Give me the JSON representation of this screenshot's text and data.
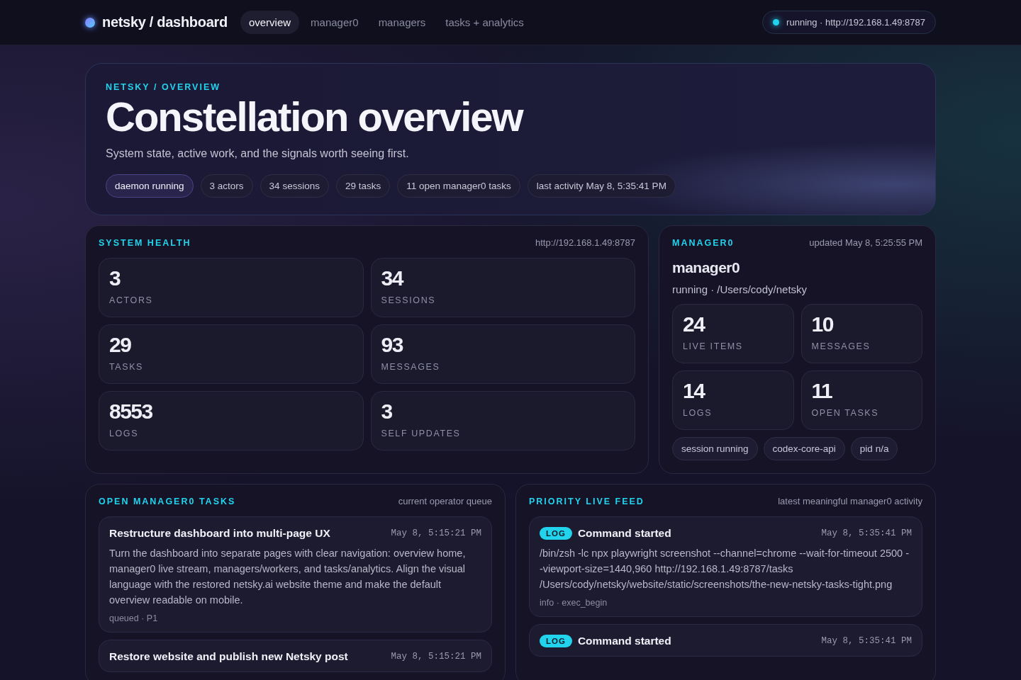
{
  "header": {
    "brand": "netsky / dashboard",
    "tabs": [
      {
        "label": "overview",
        "selected": true
      },
      {
        "label": "manager0",
        "selected": false
      },
      {
        "label": "managers",
        "selected": false
      },
      {
        "label": "tasks + analytics",
        "selected": false
      }
    ],
    "status": {
      "text": "running · http://192.168.1.49:8787",
      "on": true
    }
  },
  "hero": {
    "eyebrow": "NETSKY / OVERVIEW",
    "title": "Constellation overview",
    "subtitle": "System state, active work, and the signals worth seeing first.",
    "chips": [
      {
        "label": "daemon running",
        "kind": "status"
      },
      {
        "label": "3 actors",
        "kind": "plain"
      },
      {
        "label": "34 sessions",
        "kind": "plain"
      },
      {
        "label": "29 tasks",
        "kind": "plain"
      },
      {
        "label": "11 open manager0 tasks",
        "kind": "plain"
      },
      {
        "label": "last activity May 8, 5:35:41 PM",
        "kind": "plain"
      }
    ]
  },
  "system_health": {
    "heading": "SYSTEM HEALTH",
    "note": "http://192.168.1.49:8787",
    "stats": [
      {
        "value": "3",
        "label": "ACTORS"
      },
      {
        "value": "34",
        "label": "SESSIONS"
      },
      {
        "value": "29",
        "label": "TASKS"
      },
      {
        "value": "93",
        "label": "MESSAGES"
      },
      {
        "value": "8553",
        "label": "LOGS"
      },
      {
        "value": "3",
        "label": "SELF UPDATES"
      }
    ]
  },
  "manager": {
    "heading": "MANAGER0",
    "note": "updated May 8, 5:25:55 PM",
    "name": "manager0",
    "detail": "running · /Users/cody/netsky",
    "stats": [
      {
        "value": "24",
        "label": "LIVE ITEMS"
      },
      {
        "value": "10",
        "label": "MESSAGES"
      },
      {
        "value": "14",
        "label": "LOGS"
      },
      {
        "value": "11",
        "label": "OPEN TASKS"
      }
    ],
    "chips": [
      "session running",
      "codex-core-api",
      "pid n/a"
    ]
  },
  "open_tasks": {
    "heading": "OPEN MANAGER0 TASKS",
    "note": "current operator queue",
    "items": [
      {
        "title": "Restructure dashboard into multi-page UX",
        "time": "May 8, 5:15:21 PM",
        "body": "Turn the dashboard into separate pages with clear navigation: overview home, manager0 live stream, managers/workers, and tasks/analytics. Align the visual language with the restored netsky.ai website theme and make the default overview readable on mobile.",
        "meta": "queued · P1"
      },
      {
        "title": "Restore website and publish new Netsky post",
        "time": "May 8, 5:15:21 PM"
      }
    ]
  },
  "live_feed": {
    "heading": "PRIORITY LIVE FEED",
    "note": "latest meaningful manager0 activity",
    "items": [
      {
        "badge": "LOG",
        "title": "Command started",
        "time": "May 8, 5:35:41 PM",
        "body": "/bin/zsh -lc npx playwright screenshot --channel=chrome --wait-for-timeout 2500 --viewport-size=1440,960 http://192.168.1.49:8787/tasks /Users/cody/netsky/website/static/screenshots/the-new-netsky-tasks-tight.png",
        "meta": "info · exec_begin"
      },
      {
        "badge": "LOG",
        "title": "Command started",
        "time": "May 8, 5:35:41 PM"
      }
    ]
  }
}
